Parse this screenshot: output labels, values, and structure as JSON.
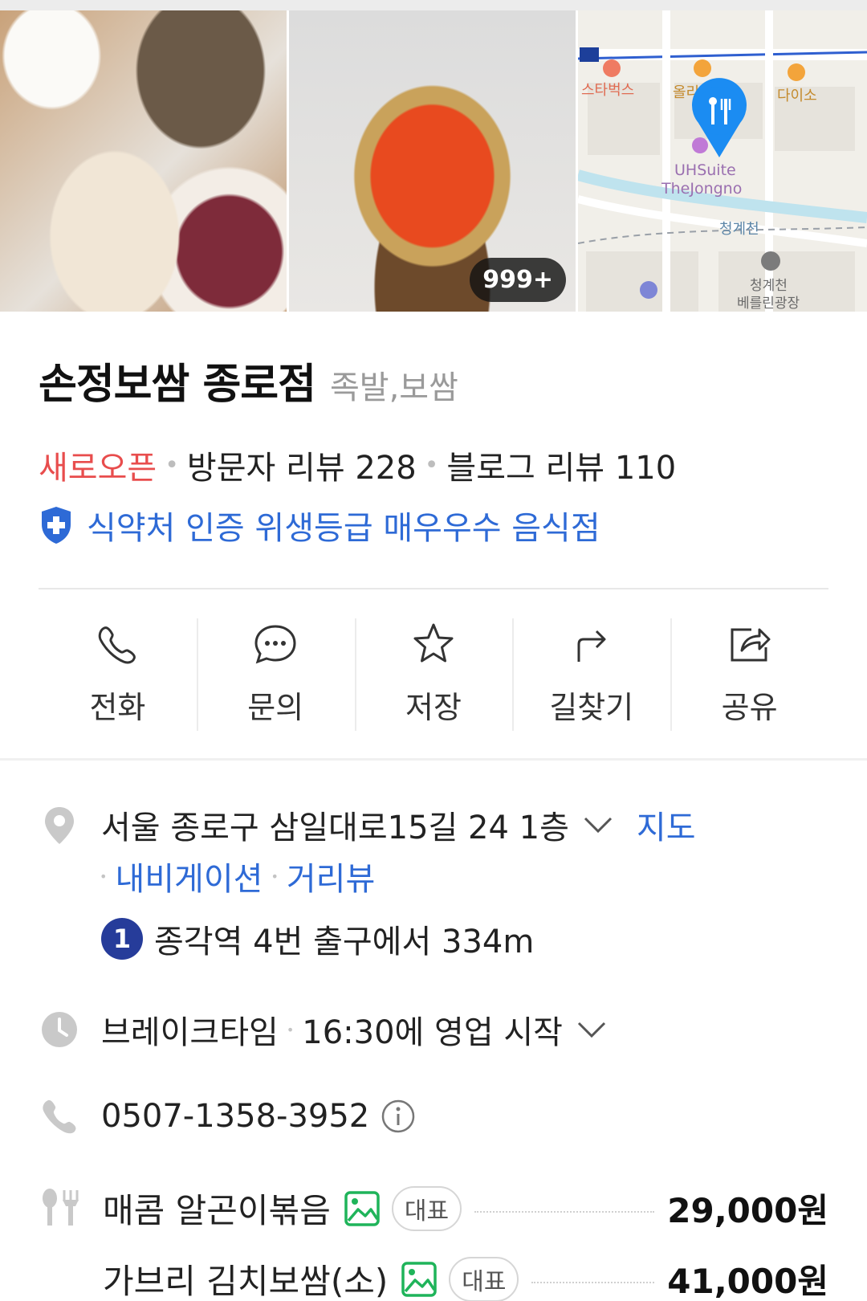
{
  "photos": {
    "count_badge": "999+",
    "map_labels": {
      "starbucks": "스타벅스",
      "oliveyoung": "올리브영",
      "daiso": "다이소",
      "hotel_line1": "UHSuite",
      "hotel_line2": "TheJongno",
      "stream": "청계천",
      "museum_line1": "청계천",
      "museum_line2": "베를린광장"
    }
  },
  "place": {
    "name": "손정보쌈 종로점",
    "category": "족발,보쌈",
    "status": "새로오픈",
    "visitor_reviews": "방문자 리뷰 228",
    "blog_reviews": "블로그 리뷰 110",
    "certification": "식약처 인증 위생등급 매우우수 음식점"
  },
  "actions": [
    {
      "label": "전화",
      "icon": "phone-icon"
    },
    {
      "label": "문의",
      "icon": "chat-icon"
    },
    {
      "label": "저장",
      "icon": "star-icon"
    },
    {
      "label": "길찾기",
      "icon": "directions-icon"
    },
    {
      "label": "공유",
      "icon": "share-icon"
    }
  ],
  "address": {
    "text": "서울 종로구 삼일대로15길 24 1층",
    "map_link": "지도",
    "navigation_link": "내비게이션",
    "streetview_link": "거리뷰",
    "subway_line": "1",
    "subway_text": "종각역 4번 출구에서 334m"
  },
  "hours": {
    "status": "브레이크타임",
    "detail": "16:30에 영업 시작"
  },
  "phone": {
    "number": "0507-1358-3952"
  },
  "menu": [
    {
      "name": "매콤 알곤이볶음",
      "tag": "대표",
      "price": "29,000원"
    },
    {
      "name": "가브리 김치보쌈(소)",
      "tag": "대표",
      "price": "41,000원"
    }
  ],
  "colors": {
    "accent_blue": "#2e6ad6",
    "new_red": "#e84d4d",
    "subway_line1": "#263c9a",
    "map_pin": "#1b8cf2"
  }
}
